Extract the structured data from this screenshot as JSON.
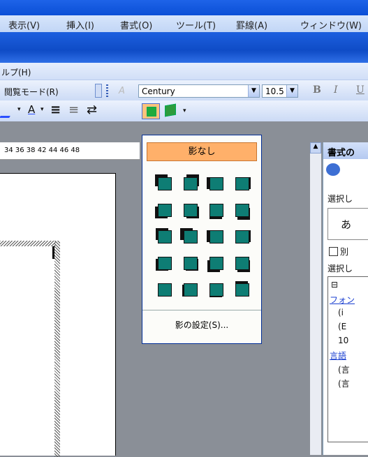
{
  "menu": [
    "表示(V)",
    "挿入(I)",
    "書式(O)",
    "ツール(T)",
    "罫線(A)",
    "ウィンドウ(W)"
  ],
  "help_menu": "ルプ(H)",
  "toolbar": {
    "read_mode": "閲覧モード(R)",
    "font_name": "Century",
    "font_size": "10.5",
    "bold": "B",
    "italic": "I",
    "underline": "U"
  },
  "ruler": {
    "marks": "34 36 38 42 44 46 48"
  },
  "dropdown": {
    "no_shadow_label": "影なし",
    "settings_label": "影の設定(S)..."
  },
  "task_pane": {
    "title": "書式の",
    "lines": [
      "選択し",
      "あ",
      "別",
      "選択し",
      "フォン",
      "(i",
      "(E",
      "10",
      "言語",
      "(言",
      "(言"
    ]
  },
  "colors": {
    "accent": "#ffb06a",
    "shadow_fill": "#0e7d74",
    "title_blue": "#0a4fd6"
  }
}
